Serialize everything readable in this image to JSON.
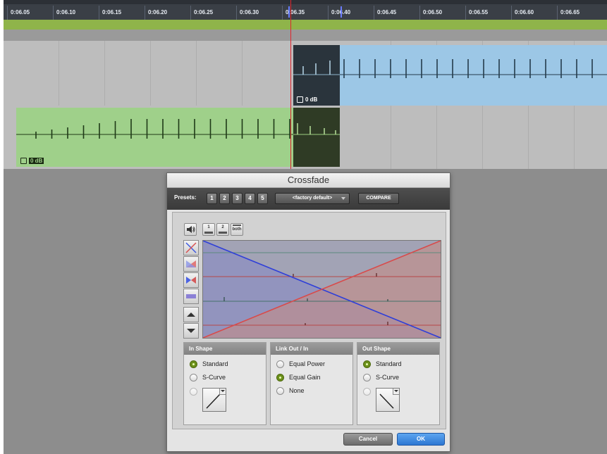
{
  "timeline": {
    "ticks": [
      "0:06.05",
      "0:06.10",
      "0:06.15",
      "0:06.20",
      "0:06.25",
      "0:06.30",
      "0:06.35",
      "0:06.40",
      "0:06.45",
      "0:06.50",
      "0:06.55",
      "0:06.60",
      "0:06.65"
    ]
  },
  "tracks": {
    "top_clip_gain": "0 dB",
    "bottom_clip_gain": "0 dB"
  },
  "colors": {
    "ruler_bg": "#3a3f46",
    "selection_bar": "#8fb44a",
    "blue_clip": "#9cc7e6",
    "green_clip": "#9fd08a",
    "crossfade_dark": "#2a343c",
    "playhead": "#e0242c",
    "fade_in_curve": "#d84b4b",
    "fade_out_curve": "#2f3fd8",
    "ok_button": "#2f7bd6"
  },
  "dialog": {
    "title": "Crossfade",
    "presets_label": "Presets:",
    "preset_buttons": [
      "1",
      "2",
      "3",
      "4",
      "5"
    ],
    "factory_preset": "<factory default>",
    "compare_label": "COMPARE",
    "toolbar": {
      "audition_icon": "speaker-icon",
      "btn1_label": "1",
      "btn2_label": "2",
      "btn3_label": "both"
    },
    "view_icons": [
      "crossfade-both-icon",
      "fade-in-icon",
      "fade-out-icon",
      "power-icon"
    ],
    "in_shape": {
      "title": "In Shape",
      "options": [
        "Standard",
        "S-Curve"
      ],
      "selected": "Standard"
    },
    "link": {
      "title": "Link Out / In",
      "options": [
        "Equal Power",
        "Equal Gain",
        "None"
      ],
      "selected": "Equal Gain"
    },
    "out_shape": {
      "title": "Out Shape",
      "options": [
        "Standard",
        "S-Curve"
      ],
      "selected": "Standard"
    },
    "cancel_label": "Cancel",
    "ok_label": "OK"
  }
}
